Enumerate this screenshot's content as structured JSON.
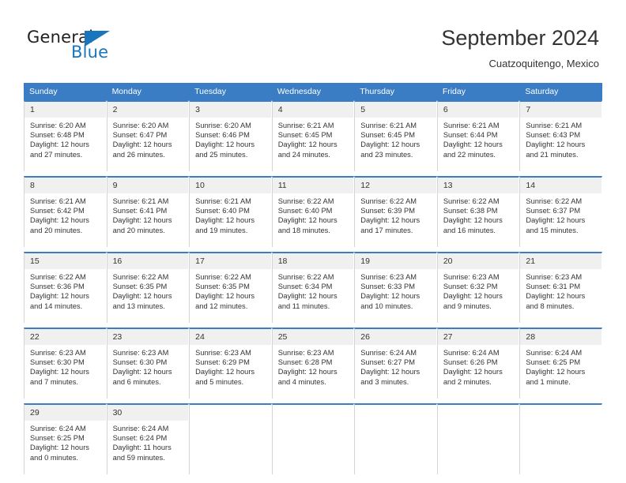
{
  "brand": {
    "name_top": "General",
    "name_bottom": "Blue",
    "color_dark": "#231f20",
    "color_blue": "#1a76bc"
  },
  "header": {
    "title": "September 2024",
    "subtitle": "Cuatzoquitengo, Mexico"
  },
  "theme": {
    "header_blue": "#3a7dc4",
    "daynum_bg": "#f0f0f0",
    "text": "#333333"
  },
  "weekdays": [
    "Sunday",
    "Monday",
    "Tuesday",
    "Wednesday",
    "Thursday",
    "Friday",
    "Saturday"
  ],
  "weeks": [
    [
      {
        "day": "1",
        "sunrise": "Sunrise: 6:20 AM",
        "sunset": "Sunset: 6:48 PM",
        "daylight1": "Daylight: 12 hours",
        "daylight2": "and 27 minutes."
      },
      {
        "day": "2",
        "sunrise": "Sunrise: 6:20 AM",
        "sunset": "Sunset: 6:47 PM",
        "daylight1": "Daylight: 12 hours",
        "daylight2": "and 26 minutes."
      },
      {
        "day": "3",
        "sunrise": "Sunrise: 6:20 AM",
        "sunset": "Sunset: 6:46 PM",
        "daylight1": "Daylight: 12 hours",
        "daylight2": "and 25 minutes."
      },
      {
        "day": "4",
        "sunrise": "Sunrise: 6:21 AM",
        "sunset": "Sunset: 6:45 PM",
        "daylight1": "Daylight: 12 hours",
        "daylight2": "and 24 minutes."
      },
      {
        "day": "5",
        "sunrise": "Sunrise: 6:21 AM",
        "sunset": "Sunset: 6:45 PM",
        "daylight1": "Daylight: 12 hours",
        "daylight2": "and 23 minutes."
      },
      {
        "day": "6",
        "sunrise": "Sunrise: 6:21 AM",
        "sunset": "Sunset: 6:44 PM",
        "daylight1": "Daylight: 12 hours",
        "daylight2": "and 22 minutes."
      },
      {
        "day": "7",
        "sunrise": "Sunrise: 6:21 AM",
        "sunset": "Sunset: 6:43 PM",
        "daylight1": "Daylight: 12 hours",
        "daylight2": "and 21 minutes."
      }
    ],
    [
      {
        "day": "8",
        "sunrise": "Sunrise: 6:21 AM",
        "sunset": "Sunset: 6:42 PM",
        "daylight1": "Daylight: 12 hours",
        "daylight2": "and 20 minutes."
      },
      {
        "day": "9",
        "sunrise": "Sunrise: 6:21 AM",
        "sunset": "Sunset: 6:41 PM",
        "daylight1": "Daylight: 12 hours",
        "daylight2": "and 20 minutes."
      },
      {
        "day": "10",
        "sunrise": "Sunrise: 6:21 AM",
        "sunset": "Sunset: 6:40 PM",
        "daylight1": "Daylight: 12 hours",
        "daylight2": "and 19 minutes."
      },
      {
        "day": "11",
        "sunrise": "Sunrise: 6:22 AM",
        "sunset": "Sunset: 6:40 PM",
        "daylight1": "Daylight: 12 hours",
        "daylight2": "and 18 minutes."
      },
      {
        "day": "12",
        "sunrise": "Sunrise: 6:22 AM",
        "sunset": "Sunset: 6:39 PM",
        "daylight1": "Daylight: 12 hours",
        "daylight2": "and 17 minutes."
      },
      {
        "day": "13",
        "sunrise": "Sunrise: 6:22 AM",
        "sunset": "Sunset: 6:38 PM",
        "daylight1": "Daylight: 12 hours",
        "daylight2": "and 16 minutes."
      },
      {
        "day": "14",
        "sunrise": "Sunrise: 6:22 AM",
        "sunset": "Sunset: 6:37 PM",
        "daylight1": "Daylight: 12 hours",
        "daylight2": "and 15 minutes."
      }
    ],
    [
      {
        "day": "15",
        "sunrise": "Sunrise: 6:22 AM",
        "sunset": "Sunset: 6:36 PM",
        "daylight1": "Daylight: 12 hours",
        "daylight2": "and 14 minutes."
      },
      {
        "day": "16",
        "sunrise": "Sunrise: 6:22 AM",
        "sunset": "Sunset: 6:35 PM",
        "daylight1": "Daylight: 12 hours",
        "daylight2": "and 13 minutes."
      },
      {
        "day": "17",
        "sunrise": "Sunrise: 6:22 AM",
        "sunset": "Sunset: 6:35 PM",
        "daylight1": "Daylight: 12 hours",
        "daylight2": "and 12 minutes."
      },
      {
        "day": "18",
        "sunrise": "Sunrise: 6:22 AM",
        "sunset": "Sunset: 6:34 PM",
        "daylight1": "Daylight: 12 hours",
        "daylight2": "and 11 minutes."
      },
      {
        "day": "19",
        "sunrise": "Sunrise: 6:23 AM",
        "sunset": "Sunset: 6:33 PM",
        "daylight1": "Daylight: 12 hours",
        "daylight2": "and 10 minutes."
      },
      {
        "day": "20",
        "sunrise": "Sunrise: 6:23 AM",
        "sunset": "Sunset: 6:32 PM",
        "daylight1": "Daylight: 12 hours",
        "daylight2": "and 9 minutes."
      },
      {
        "day": "21",
        "sunrise": "Sunrise: 6:23 AM",
        "sunset": "Sunset: 6:31 PM",
        "daylight1": "Daylight: 12 hours",
        "daylight2": "and 8 minutes."
      }
    ],
    [
      {
        "day": "22",
        "sunrise": "Sunrise: 6:23 AM",
        "sunset": "Sunset: 6:30 PM",
        "daylight1": "Daylight: 12 hours",
        "daylight2": "and 7 minutes."
      },
      {
        "day": "23",
        "sunrise": "Sunrise: 6:23 AM",
        "sunset": "Sunset: 6:30 PM",
        "daylight1": "Daylight: 12 hours",
        "daylight2": "and 6 minutes."
      },
      {
        "day": "24",
        "sunrise": "Sunrise: 6:23 AM",
        "sunset": "Sunset: 6:29 PM",
        "daylight1": "Daylight: 12 hours",
        "daylight2": "and 5 minutes."
      },
      {
        "day": "25",
        "sunrise": "Sunrise: 6:23 AM",
        "sunset": "Sunset: 6:28 PM",
        "daylight1": "Daylight: 12 hours",
        "daylight2": "and 4 minutes."
      },
      {
        "day": "26",
        "sunrise": "Sunrise: 6:24 AM",
        "sunset": "Sunset: 6:27 PM",
        "daylight1": "Daylight: 12 hours",
        "daylight2": "and 3 minutes."
      },
      {
        "day": "27",
        "sunrise": "Sunrise: 6:24 AM",
        "sunset": "Sunset: 6:26 PM",
        "daylight1": "Daylight: 12 hours",
        "daylight2": "and 2 minutes."
      },
      {
        "day": "28",
        "sunrise": "Sunrise: 6:24 AM",
        "sunset": "Sunset: 6:25 PM",
        "daylight1": "Daylight: 12 hours",
        "daylight2": "and 1 minute."
      }
    ],
    [
      {
        "day": "29",
        "sunrise": "Sunrise: 6:24 AM",
        "sunset": "Sunset: 6:25 PM",
        "daylight1": "Daylight: 12 hours",
        "daylight2": "and 0 minutes."
      },
      {
        "day": "30",
        "sunrise": "Sunrise: 6:24 AM",
        "sunset": "Sunset: 6:24 PM",
        "daylight1": "Daylight: 11 hours",
        "daylight2": "and 59 minutes."
      },
      null,
      null,
      null,
      null,
      null
    ]
  ]
}
